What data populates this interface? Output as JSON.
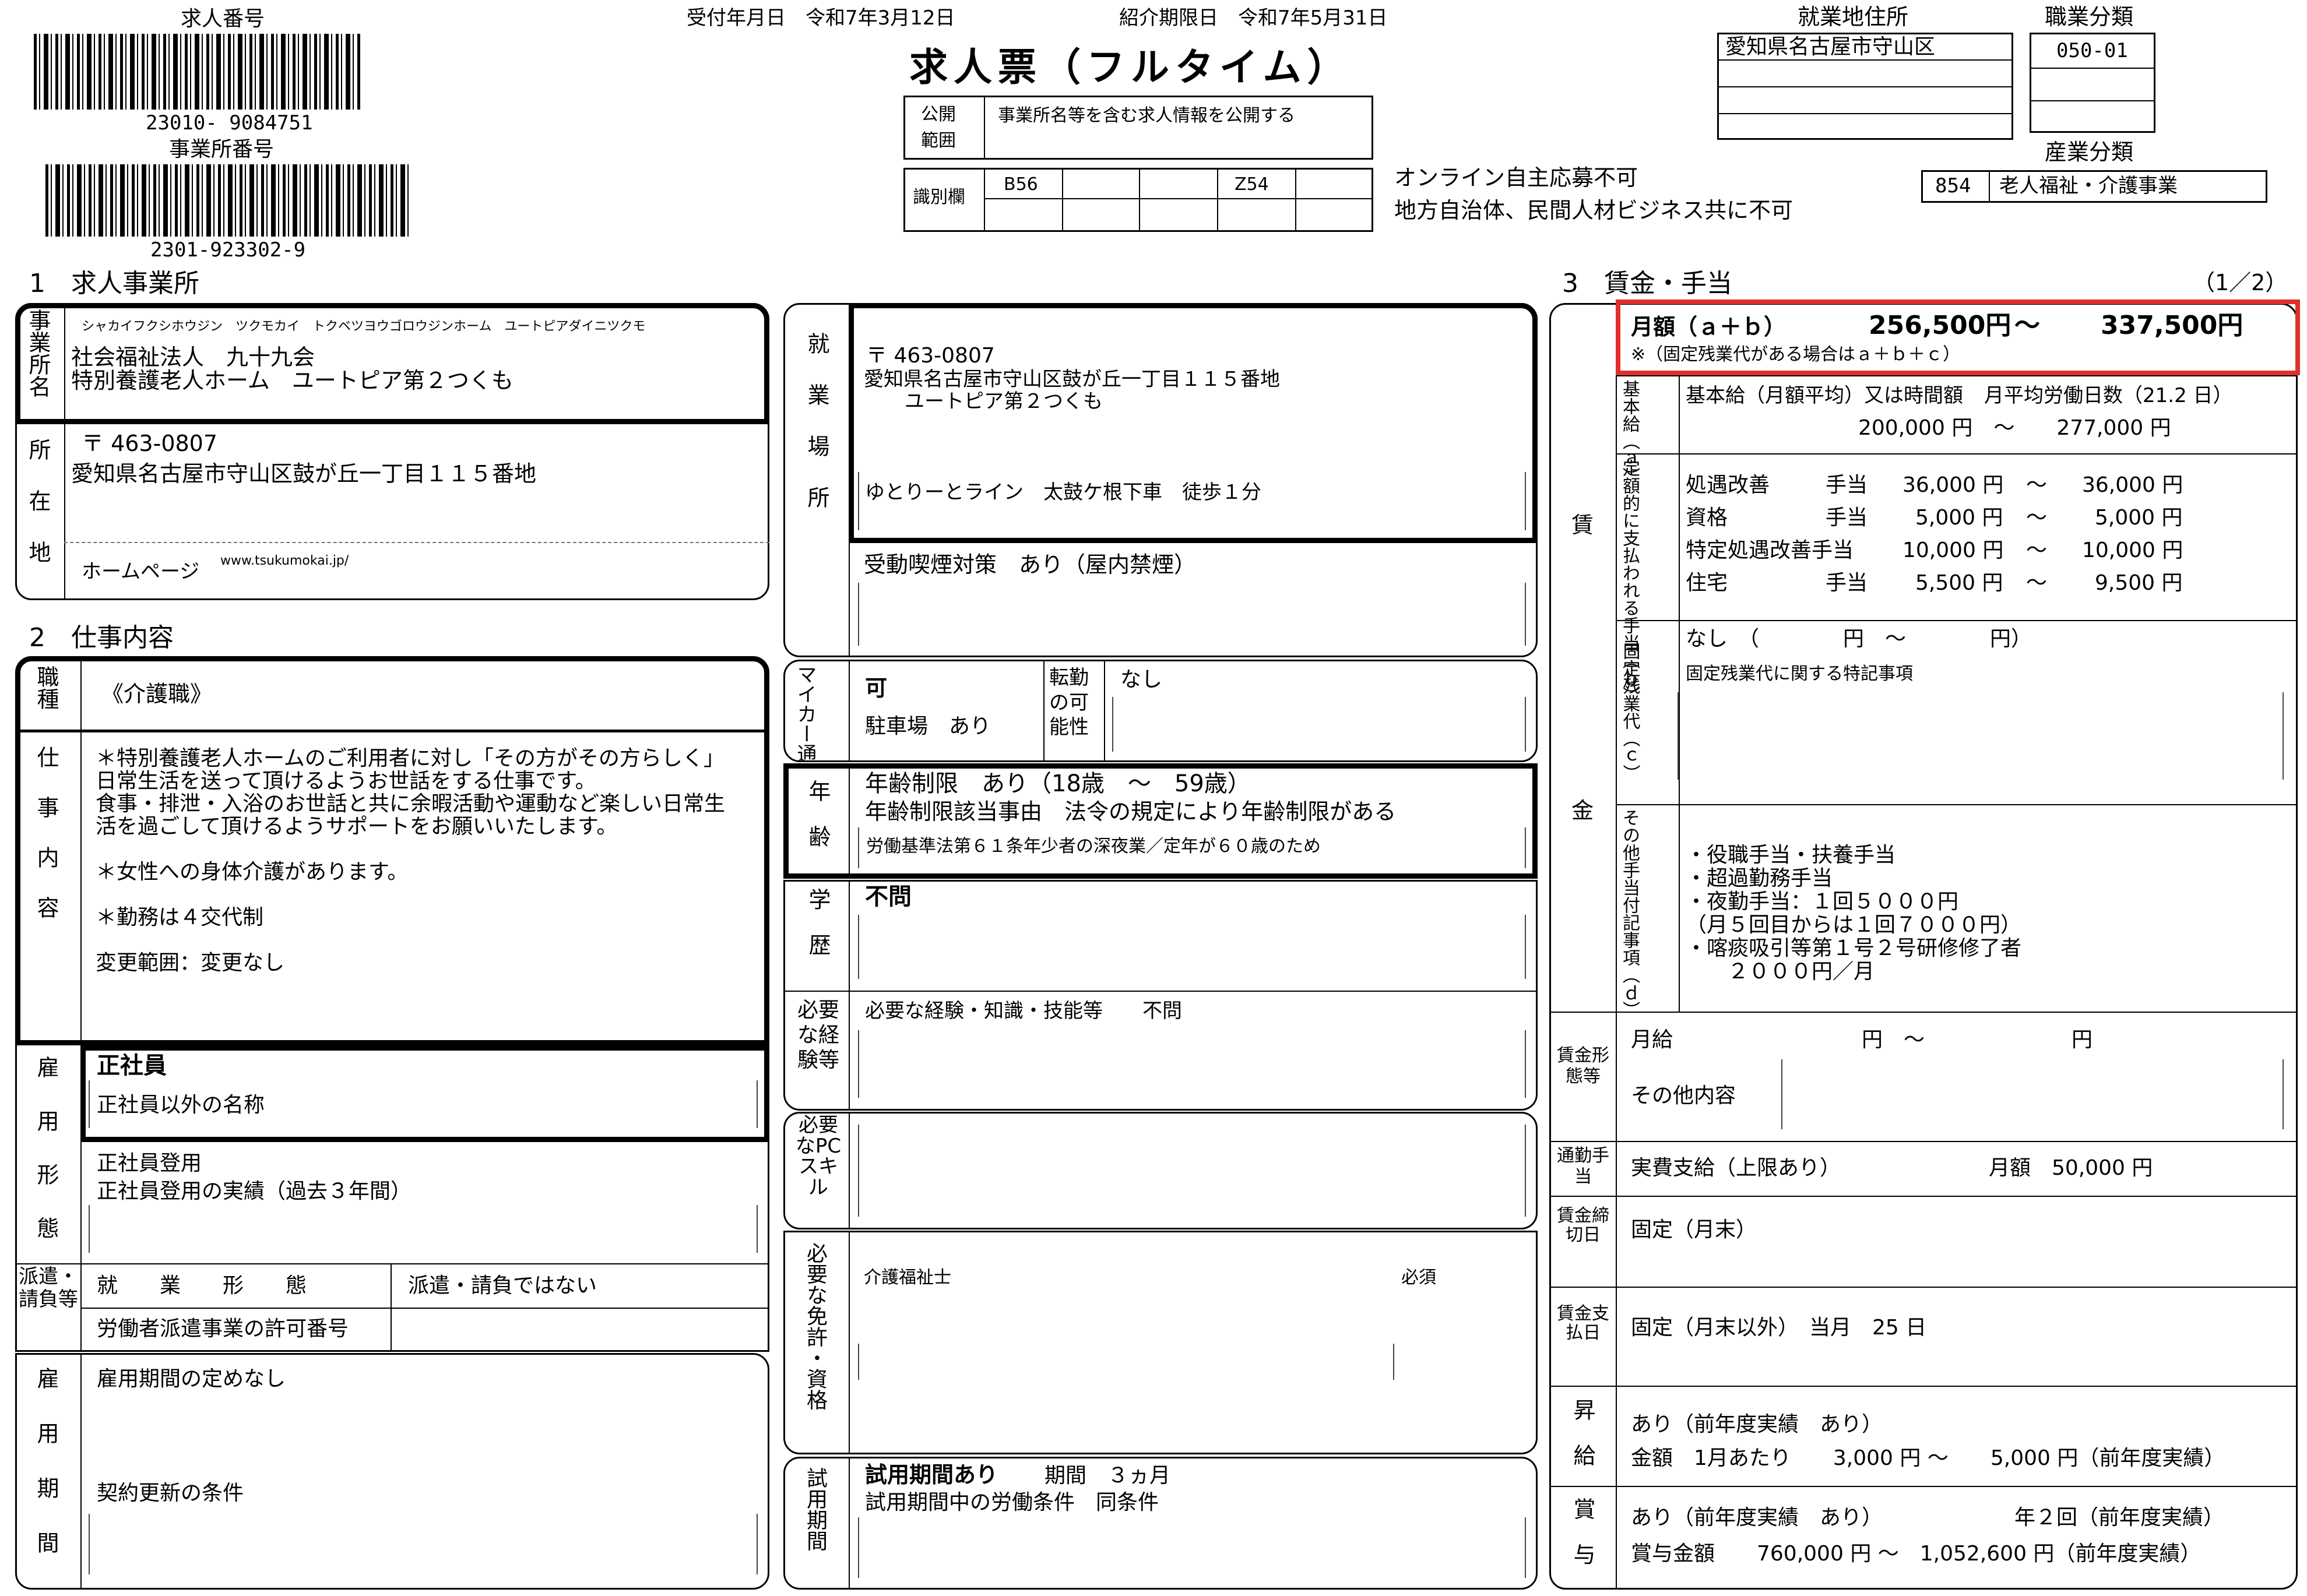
{
  "header": {
    "job_number_label": "求人番号",
    "job_number": "23010- 9084751",
    "office_number_label": "事業所番号",
    "office_number": "2301-923302-9",
    "received_date": "受付年月日　令和7年3月12日",
    "intro_deadline": "紹介期限日　令和7年5月31日",
    "title": "求人票（フルタイム）",
    "publish_label": "公開範囲",
    "publish_value": "事業所名等を含む求人情報を公開する",
    "id_label": "識別欄",
    "id_cells": [
      "B56",
      "",
      "",
      "Z54",
      ""
    ],
    "online_note": "オンライン自主応募不可",
    "agency_note": "地方自治体、民間人材ビジネス共に不可",
    "work_address_label": "就業地住所",
    "work_address_lines": [
      "愛知県名古屋市守山区",
      "",
      "",
      ""
    ],
    "occupation_label": "職業分類",
    "occupation_code": "050-01",
    "industry_label": "産業分類",
    "industry_code": "854",
    "industry_name": "老人福祉・介護事業"
  },
  "section1": {
    "heading": "1　求人事業所",
    "name_label": "事業所名",
    "kana": "シャカイフクシホウジン　ツクモカイ　トクベツヨウゴロウジンホーム　ユートピアダイニツクモ",
    "name_line1": "社会福祉法人　九十九会",
    "name_line2": "特別養護老人ホーム　ユートピア第２つくも",
    "address_label": "所在地",
    "postal": "〒 463-0807",
    "address": "愛知県名古屋市守山区鼓が丘一丁目１１５番地",
    "homepage_label": "ホームページ",
    "homepage": "www.tsukumokai.jp/"
  },
  "workplace": {
    "label": "就業場所",
    "postal": "〒 463-0807",
    "address": "愛知県名古屋市守山区鼓が丘一丁目１１５番地",
    "facility": "ユートピア第２つくも",
    "access": "ゆとりーとライン　太鼓ケ根下車　徒歩１分",
    "smoking": "受動喫煙対策　あり（屋内禁煙）"
  },
  "section2": {
    "heading": "2　仕事内容",
    "job_type_label": "職種",
    "job_type": "《介護職》",
    "content_label": "仕事内容",
    "content_lines": [
      "＊特別養護老人ホームのご利用者に対し「その方がその方らしく」",
      "日常生活を送って頂けるようお世話をする仕事です。",
      "食事・排泄・入浴のお世話と共に余暇活動や運動など楽しい日常生",
      "活を過ごして頂けるようサポートをお願いいたします。",
      "",
      "＊女性への身体介護があります。",
      "",
      "＊勤務は４交代制",
      "",
      "変更範囲：変更なし"
    ],
    "employment_label": "雇用形態",
    "employment_value": "正社員",
    "non_regular_name": "正社員以外の名称",
    "promotion": "正社員登用",
    "promotion_record": "正社員登用の実績（過去３年間）",
    "dispatch_label": "派遣・請負等",
    "dispatch_form_label": "就　　業　　形　　態",
    "dispatch_form_value": "派遣・請負ではない",
    "dispatch_license_label": "労働者派遣事業の許可番号",
    "period_label": "雇用期間",
    "period_value": "雇用期間の定めなし",
    "renewal_label": "契約更新の条件"
  },
  "middle": {
    "mycar_label": "マイカー通勤",
    "mycar_value": "可",
    "parking": "駐車場　あり",
    "transfer_label": "転勤の可能性",
    "transfer_value": "なし",
    "age_label": "年齢",
    "age_limit": "年齢制限　あり（18歳　～　59歳）",
    "age_reason": "年齢制限該当事由　法令の規定により年齢制限がある",
    "age_detail": "労働基準法第６１条年少者の深夜業／定年が６０歳のため",
    "education_label": "学歴",
    "education_value": "不問",
    "experience_label": "必要な経験等",
    "experience_value": "必要な経験・知識・技能等　　不問",
    "pc_label": "必要なPCスキル",
    "license_label": "必要な免許・資格",
    "license_name": "介護福祉士",
    "license_req": "必須",
    "trial_label": "試用期間",
    "trial_value": "試用期間あり",
    "trial_period": "期間　３ヵ月",
    "trial_conditions": "試用期間中の労働条件　同条件"
  },
  "section3": {
    "heading": "3　賃金・手当",
    "page": "（1／2）",
    "wage_label": "賃金",
    "monthly_label": "月額（ａ＋ｂ）",
    "monthly_min": "256,500円",
    "monthly_tilde": "～",
    "monthly_max": "337,500円",
    "monthly_note": "※（固定残業代がある場合はａ＋ｂ＋ｃ）",
    "base_label": "基本給（ａ）",
    "base_desc": "基本給（月額平均）又は時間額",
    "work_days": "月平均労働日数（21.2 日）",
    "base_range": "200,000 円　～　　277,000 円",
    "fixed_label": "定額的に支払われる手当（ｂ）",
    "allowances": [
      {
        "name": "処遇改善",
        "unit": "手当",
        "min": "36,000 円",
        "max": "36,000 円"
      },
      {
        "name": "資格",
        "unit": "手当",
        "min": "5,000 円",
        "max": "5,000 円"
      },
      {
        "name": "特定処遇改善手当",
        "unit": "手当",
        "min": "10,000 円",
        "max": "10,000 円"
      },
      {
        "name": "住宅",
        "unit": "手当",
        "min": "5,500 円",
        "max": "9,500 円"
      }
    ],
    "overtime_label": "固定残業代（ｃ）",
    "overtime_value": "なし　（　　　　円　～　　　　円）",
    "overtime_note": "固定残業代に関する特記事項",
    "other_label": "その他手当付記事項（ｄ）",
    "other_lines": [
      "・役職手当・扶養手当",
      "・超過勤務手当",
      "・夜勤手当：１回５０００円",
      "（月５回目からは１回７０００円）",
      "・喀痰吸引等第１号２号研修修了者",
      "　　２０００円／月"
    ],
    "wage_form_label": "賃金形態等",
    "wage_form_value": "月給　　　　　　　　　円　～　　　　　　　円",
    "wage_form_other": "その他内容",
    "commute_label": "通勤手当",
    "commute_value": "実費支給（上限あり）",
    "commute_amount": "月額　50,000 円",
    "closing_label": "賃金締切日",
    "closing_value": "固定（月末）",
    "payday_label": "賃金支払日",
    "payday_value": "固定（月末以外）　当月　25 日",
    "raise_label": "昇給",
    "raise_value": "あり（前年度実績　あり）",
    "raise_amount": "金額　1月あたり　　3,000 円 ～　　5,000 円（前年度実績）",
    "bonus_label": "賞与",
    "bonus_value": "あり（前年度実績　あり）",
    "bonus_times": "年２回（前年度実績）",
    "bonus_amount": "賞与金額　　760,000 円 ～　1,052,600 円（前年度実績）"
  },
  "colors": {
    "highlight": "#e0302a"
  }
}
